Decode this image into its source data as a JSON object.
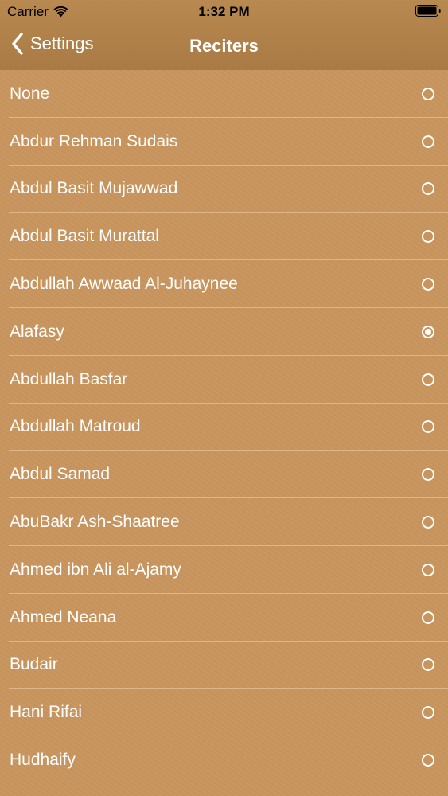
{
  "status_bar": {
    "carrier": "Carrier",
    "time": "1:32 PM"
  },
  "nav": {
    "back_label": "Settings",
    "title": "Reciters"
  },
  "reciters": [
    {
      "label": "None",
      "selected": false
    },
    {
      "label": "Abdur Rehman Sudais",
      "selected": false
    },
    {
      "label": "Abdul Basit Mujawwad",
      "selected": false
    },
    {
      "label": "Abdul Basit Murattal",
      "selected": false
    },
    {
      "label": "Abdullah Awwaad Al-Juhaynee",
      "selected": false
    },
    {
      "label": "Alafasy",
      "selected": true
    },
    {
      "label": "Abdullah Basfar",
      "selected": false
    },
    {
      "label": "Abdullah Matroud",
      "selected": false
    },
    {
      "label": "Abdul Samad",
      "selected": false
    },
    {
      "label": "AbuBakr Ash-Shaatree",
      "selected": false
    },
    {
      "label": "Ahmed ibn Ali al-Ajamy",
      "selected": false
    },
    {
      "label": "Ahmed Neana",
      "selected": false
    },
    {
      "label": "Budair",
      "selected": false
    },
    {
      "label": "Hani Rifai",
      "selected": false
    },
    {
      "label": "Hudhaify",
      "selected": false
    }
  ],
  "colors": {
    "header": "#b08048",
    "background": "#c8955e",
    "text": "#ffffff",
    "separator": "#f0d2aa"
  },
  "icons": {
    "back": "chevron-left-icon",
    "wifi": "wifi-icon",
    "battery": "battery-icon",
    "radio": "radio-button-icon"
  }
}
